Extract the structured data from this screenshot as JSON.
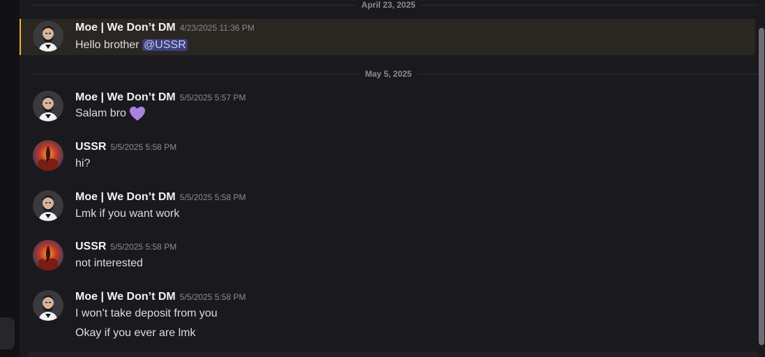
{
  "dividers": [
    {
      "label": "April 23, 2025"
    },
    {
      "label": "May 5, 2025"
    }
  ],
  "messages": [
    {
      "username": "Moe | We Don’t DM",
      "timestamp": "4/23/2025 11:36 PM",
      "text": "Hello brother ",
      "mention": "@USSR",
      "avatar": "moe-avatar"
    },
    {
      "username": "Moe | We Don’t DM",
      "timestamp": "5/5/2025 5:57 PM",
      "text": "Salam bro ",
      "emoji": "purple-heart-emoji",
      "avatar": "moe-avatar"
    },
    {
      "username": "USSR",
      "timestamp": "5/5/2025 5:58 PM",
      "text": "hi?",
      "avatar": "ussr-avatar"
    },
    {
      "username": "Moe | We Don’t DM",
      "timestamp": "5/5/2025 5:58 PM",
      "text": "Lmk if you want work",
      "avatar": "moe-avatar"
    },
    {
      "username": "USSR",
      "timestamp": "5/5/2025 5:58 PM",
      "text": "not interested",
      "avatar": "ussr-avatar"
    },
    {
      "username": "Moe | We Don’t DM",
      "timestamp": "5/5/2025 5:58 PM",
      "text": "I won’t take deposit from you",
      "text2": "Okay if you ever are lmk",
      "avatar": "moe-avatar"
    }
  ],
  "colors": {
    "background": "#1a1a1e",
    "highlight": "#2a2621",
    "highlight_bar": "#f0b232",
    "mention_bg": "#3b3f78",
    "heart": "#a883dd"
  }
}
